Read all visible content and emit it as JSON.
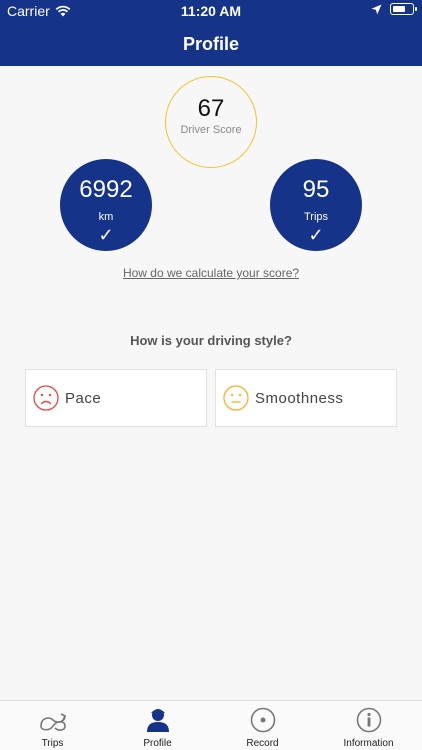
{
  "status": {
    "carrier": "Carrier",
    "time": "11:20 AM"
  },
  "header": {
    "title": "Profile"
  },
  "score": {
    "value": "67",
    "label": "Driver Score"
  },
  "stats": {
    "distance": {
      "value": "6992",
      "unit": "km"
    },
    "trips": {
      "value": "95",
      "unit": "Trips"
    }
  },
  "calc_link": "How do we calculate your score?",
  "question": "How is your driving style?",
  "styles": [
    {
      "label": "Pace",
      "mood": "sad",
      "color": "#e84545"
    },
    {
      "label": "Smoothness",
      "mood": "neutral",
      "color": "#f3b325"
    }
  ],
  "tabs": [
    {
      "label": "Trips",
      "icon": "trips-icon"
    },
    {
      "label": "Profile",
      "icon": "profile-icon",
      "active": true
    },
    {
      "label": "Record",
      "icon": "record-icon"
    },
    {
      "label": "Information",
      "icon": "info-icon"
    }
  ],
  "colors": {
    "brand": "#16338a",
    "score_ring": "#f3c325"
  }
}
